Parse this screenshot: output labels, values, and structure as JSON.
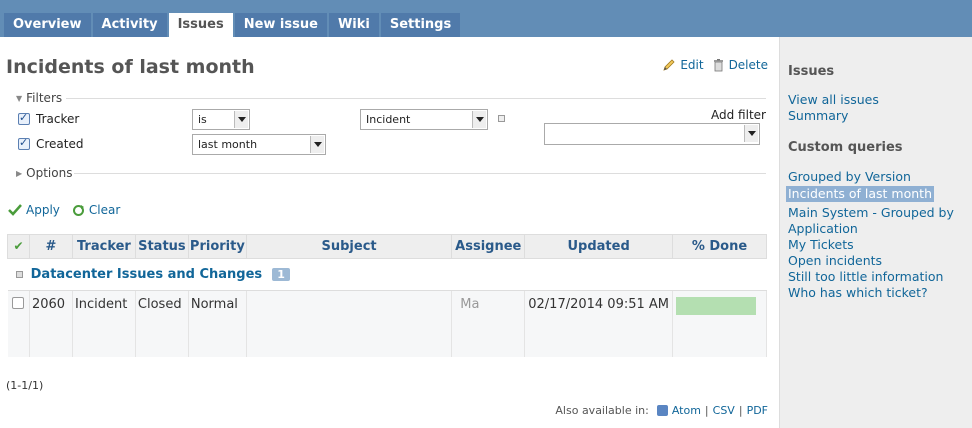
{
  "tabs": [
    {
      "label": "Overview"
    },
    {
      "label": "Activity"
    },
    {
      "label": "Issues"
    },
    {
      "label": "New issue"
    },
    {
      "label": "Wiki"
    },
    {
      "label": "Settings"
    }
  ],
  "page": {
    "title": "Incidents of last month",
    "edit_label": "Edit",
    "delete_label": "Delete"
  },
  "filters": {
    "legend": "Filters",
    "tracker_label": "Tracker",
    "tracker_operator": "is",
    "tracker_value": "Incident",
    "created_label": "Created",
    "created_value": "last month",
    "add_filter_label": "Add filter",
    "add_filter_value": ""
  },
  "options": {
    "legend": "Options"
  },
  "actions": {
    "apply_label": "Apply",
    "clear_label": "Clear"
  },
  "table": {
    "headers": [
      "#",
      "Tracker",
      "Status",
      "Priority",
      "Subject",
      "Assignee",
      "Updated",
      "% Done"
    ],
    "group": {
      "name": "Datacenter Issues and Changes",
      "count": "1"
    },
    "rows": [
      {
        "id": "2060",
        "tracker": "Incident",
        "status": "Closed",
        "priority": "Normal",
        "subject": "",
        "assignee": "Ma",
        "updated": "02/17/2014 09:51 AM",
        "done_fraction": 1.0
      }
    ]
  },
  "pagination": "(1-1/1)",
  "formats": {
    "prefix": "Also available in:",
    "atom": "Atom",
    "csv": "CSV",
    "pdf": "PDF",
    "sep": "|"
  },
  "sidebar": {
    "issues_heading": "Issues",
    "view_all": "View all issues",
    "summary": "Summary",
    "queries_heading": "Custom queries",
    "queries": [
      "Grouped by Version",
      "Incidents of last month",
      "Main System - Grouped by",
      "Application",
      "My Tickets",
      "Open incidents",
      "Still too little information",
      "Who has which ticket?"
    ]
  },
  "colors": {
    "header": "#628db6",
    "tab": "#507aaa",
    "link": "#169",
    "progress": "#b4dfb1"
  }
}
